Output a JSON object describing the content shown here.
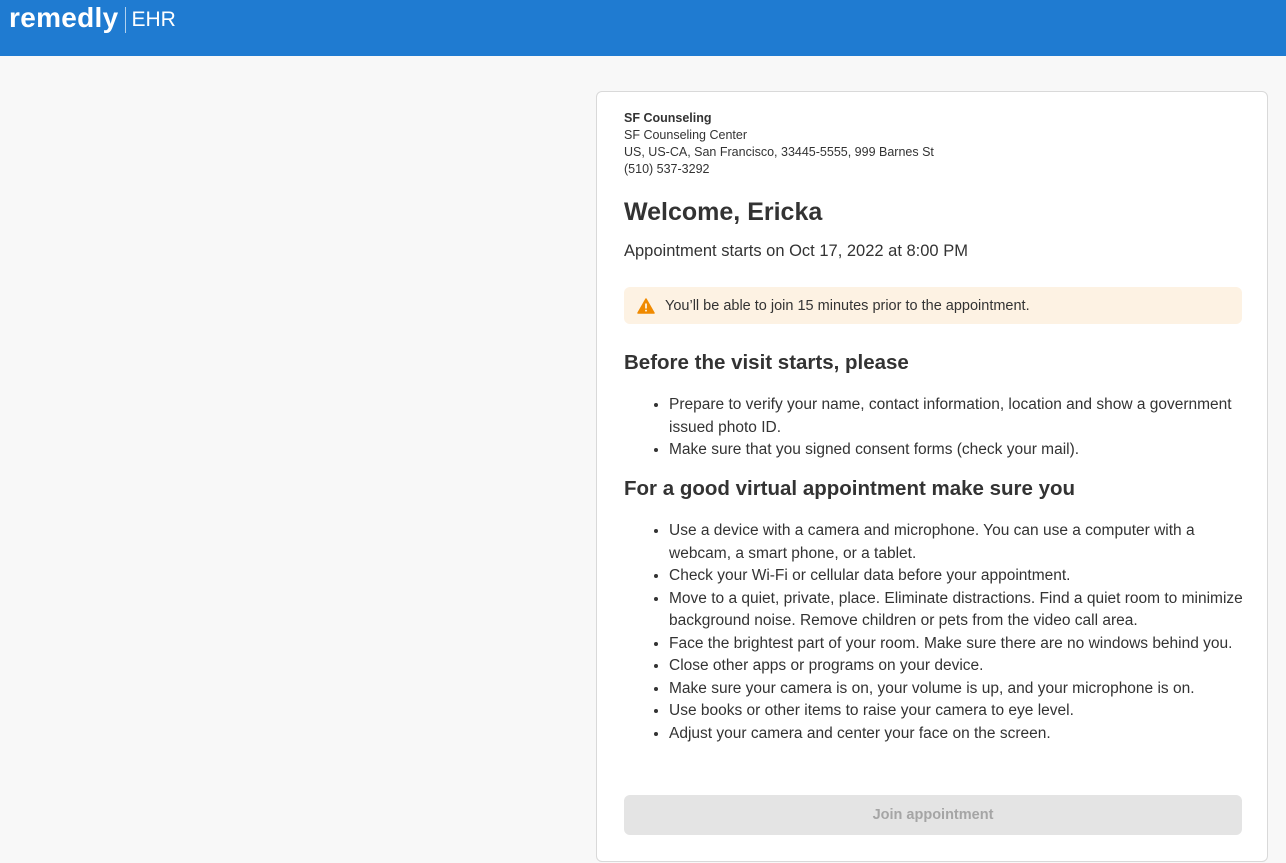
{
  "header": {
    "logo_main": "remedly",
    "logo_sub": "EHR",
    "brand_color": "#1f7bd1"
  },
  "practice": {
    "name": "SF Counseling",
    "center": "SF Counseling Center",
    "address": "US, US-CA, San Francisco, 33445-5555, 999 Barnes St",
    "phone": "(510) 537-3292"
  },
  "welcome": {
    "title": "Welcome, Ericka",
    "appointment_text": "Appointment starts on Oct 17, 2022 at 8:00 PM"
  },
  "notice": {
    "icon": "warning-icon",
    "text": "You’ll be able to join 15 minutes prior to the appointment.",
    "color": "#fdf2e3"
  },
  "before_visit": {
    "title": "Before the visit starts, please",
    "items": [
      "Prepare to verify your name, contact information, location and show a government issued photo ID.",
      "Make sure that you signed consent forms (check your mail)."
    ]
  },
  "virtual_tips": {
    "title": "For a good virtual appointment make sure you",
    "items": [
      "Use a device with a camera and microphone. You can use a computer with a webcam, a smart phone, or a tablet.",
      "Check your Wi-Fi or cellular data before your appointment.",
      "Move to a quiet, private, place. Eliminate distractions. Find a quiet room to minimize background noise. Remove children or pets from the video call area.",
      "Face the brightest part of your room. Make sure there are no windows behind you.",
      "Close other apps or programs on your device.",
      "Make sure your camera is on, your volume is up, and your microphone is on.",
      "Use books or other items to raise your camera to eye level.",
      "Adjust your camera and center your face on the screen."
    ]
  },
  "actions": {
    "join_label": "Join appointment",
    "join_disabled": true
  }
}
